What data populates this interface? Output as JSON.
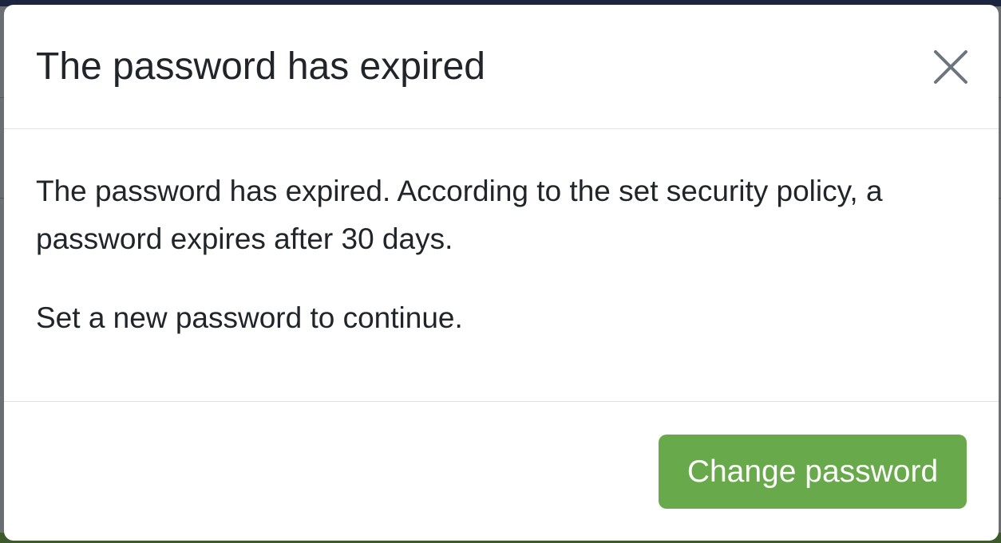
{
  "dialog": {
    "title": "The password has expired",
    "close_icon": "close-icon",
    "body": {
      "paragraphs": [
        "The password has expired. According to the set security policy, a password expires after 30 days.",
        "Set a new password to continue."
      ]
    },
    "footer": {
      "primary_button_label": "Change password"
    }
  },
  "colors": {
    "primary_button": "#68a94b",
    "text": "#212529",
    "divider": "#dee2e6",
    "backdrop": "#6c6f72"
  }
}
